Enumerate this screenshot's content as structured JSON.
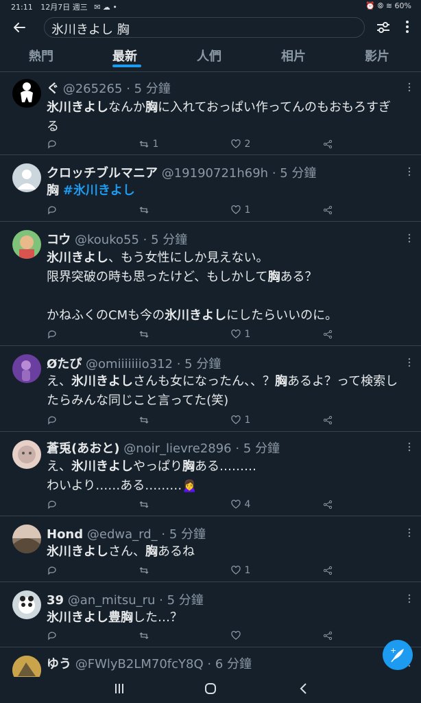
{
  "status": {
    "time": "21:11",
    "date": "12月7日 週三",
    "battery": "60%"
  },
  "search": {
    "query": "氷川きよし 胸"
  },
  "tabs": [
    "熱門",
    "最新",
    "人們",
    "相片",
    "影片"
  ],
  "tweets": [
    {
      "name": "ぐ",
      "handle": "@265265",
      "time": "· 5 分鐘",
      "kw": "氷川きよし",
      "text_a": "なんか",
      "kw2": "胸",
      "text_b": "に入れておっぱい作ってんのもおもろすぎる",
      "reply": "",
      "retweet": "1",
      "like": "2"
    },
    {
      "name": "クロッチブルマニア",
      "handle": "@19190721h69h",
      "time": "· 5 分鐘",
      "kw": "胸",
      "tag": "#氷川きよし",
      "reply": "",
      "retweet": "",
      "like": "1"
    },
    {
      "name": "コウ",
      "handle": "@kouko55",
      "time": "· 5 分鐘",
      "kw": "氷川きよし",
      "text_a": "、もう女性にしか見えない。\n限界突破の時も思ったけど、もしかして",
      "kw2": "胸",
      "text_b": "ある？\n\nかねふくのCMも今の",
      "kw3": "氷川きよし",
      "text_c": "にしたらいいのに。",
      "reply": "",
      "retweet": "",
      "like": "1"
    },
    {
      "name": "Øたぴ",
      "handle": "@omiiiiiiio312",
      "time": "· 5 分鐘",
      "text_pre": "え、",
      "kw": "氷川きよし",
      "text_a": "さんも女になったん、、？",
      "kw2": "胸",
      "text_b": "あるよ？って検索したらみんな同じこと言ってた(笑)",
      "reply": "",
      "retweet": "",
      "like": "1"
    },
    {
      "name": "蒼兎(あおと)",
      "handle": "@noir_lievre2896",
      "time": "· 5 分鐘",
      "text_pre": "え、",
      "kw": "氷川きよし",
      "text_a": "やっぱり",
      "kw2": "胸",
      "text_b": "ある………\nわいより……ある………🙍‍♀️",
      "reply": "",
      "retweet": "",
      "like": "4"
    },
    {
      "name": "Hond",
      "handle": "@edwa_rd_",
      "time": "· 5 分鐘",
      "kw": "氷川きよし",
      "text_a": "さん、",
      "kw2": "胸",
      "text_b": "あるね",
      "reply": "",
      "retweet": "",
      "like": "1"
    },
    {
      "name": "39",
      "handle": "@an_mitsu_ru",
      "time": "· 5 分鐘",
      "kw": "氷川きよし豊胸",
      "text_a": "した…？",
      "reply": "",
      "retweet": "",
      "like": ""
    },
    {
      "name": "ゆう",
      "handle": "@FWlyB2LM70fcY8Q",
      "time": "· 6 分鐘"
    }
  ],
  "colors": {
    "accent": "#1d9bf0",
    "bg": "#15202b",
    "muted": "#8b98a5"
  }
}
